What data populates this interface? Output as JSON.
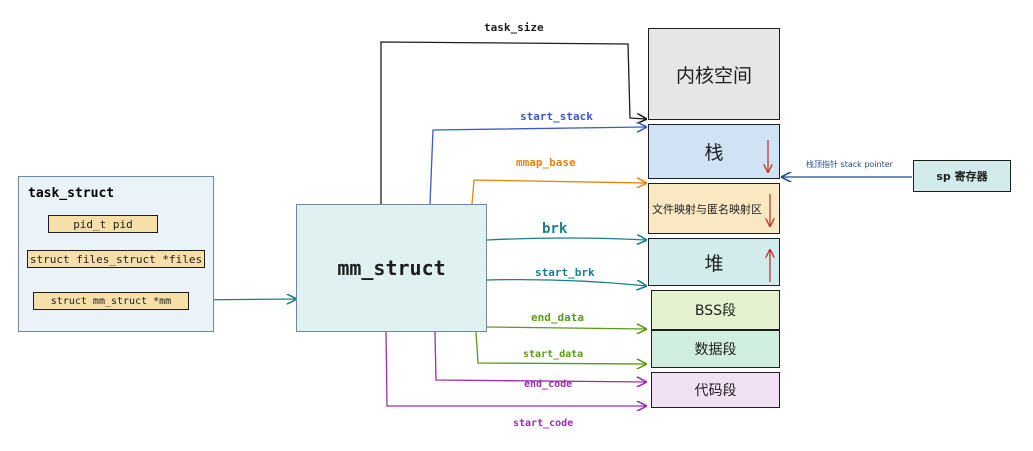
{
  "task_struct": {
    "title": "task_struct",
    "fields": [
      "pid_t  pid",
      "struct files_struct *files",
      "struct mm_struct    *mm"
    ]
  },
  "mm_struct": {
    "title": "mm_struct"
  },
  "segments": {
    "kernel": "内核空间",
    "stack": "栈",
    "mmap": "文件映射与匿名映射区",
    "heap": "堆",
    "bss": "BSS段",
    "data": "数据段",
    "code": "代码段"
  },
  "sp": {
    "label": "sp  寄存器",
    "note": "栈顶指针 stack pointer"
  },
  "edges": {
    "task_size": "task_size",
    "start_stack": "start_stack",
    "mmap_base": "mmap_base",
    "brk": "brk",
    "start_brk": "start_brk",
    "end_data": "end_data",
    "start_data": "start_data",
    "end_code": "end_code",
    "start_code": "start_code"
  },
  "colors": {
    "blue": "#3b5bc4",
    "orange": "#e8830c",
    "teal": "#1a7f8a",
    "green": "#5a9a1a",
    "purple": "#9a2fb0",
    "red": "#c0392b"
  }
}
